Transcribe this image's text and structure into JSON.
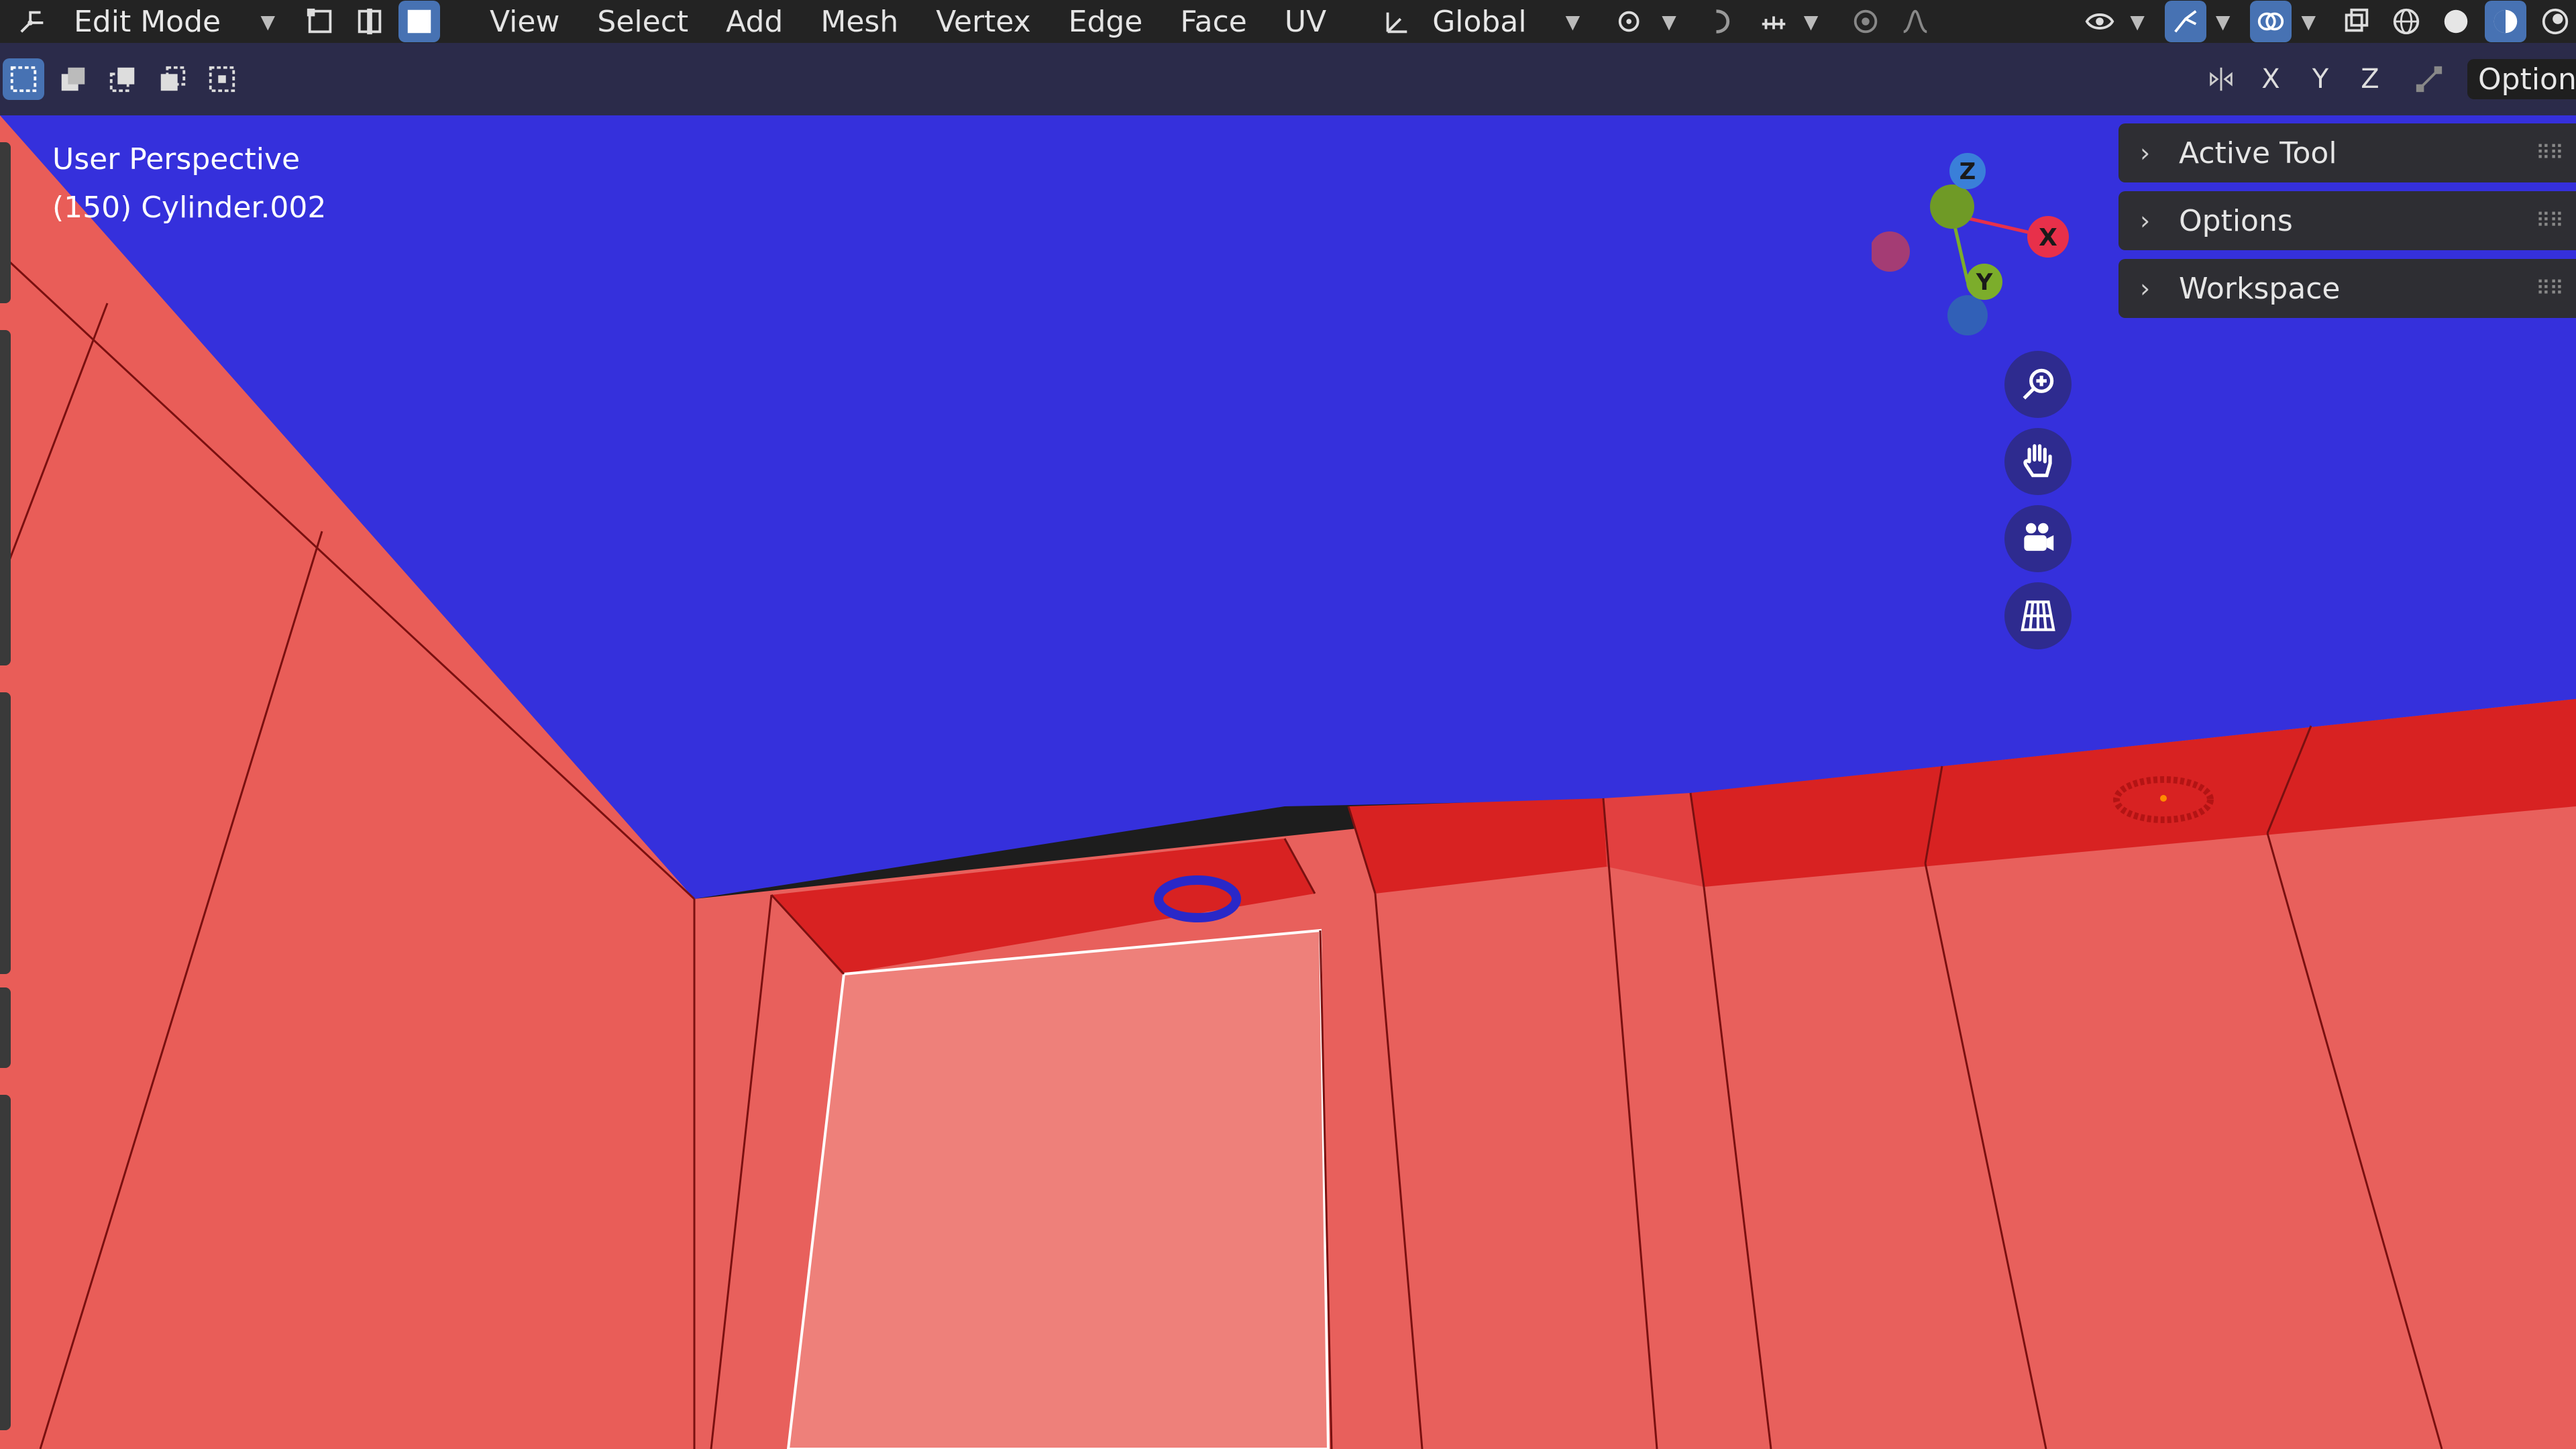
{
  "topbar": {
    "mode_label": "Edit Mode",
    "menus": [
      "View",
      "Select",
      "Add",
      "Mesh",
      "Vertex",
      "Edge",
      "Face",
      "UV"
    ],
    "orientation_label": "Global"
  },
  "toolbar2": {
    "axes": [
      "X",
      "Y",
      "Z"
    ],
    "options_label": "Option"
  },
  "viewport": {
    "view_name": "User Perspective",
    "object_info": "(150) Cylinder.002"
  },
  "npanel": {
    "sections": [
      "Active Tool",
      "Options",
      "Workspace"
    ]
  },
  "gizmo": {
    "labels": {
      "x": "X",
      "y": "Y",
      "z": "Z"
    },
    "colors": {
      "x": "#e8304a",
      "y": "#7cad2b",
      "z": "#3a7fd9"
    }
  },
  "colors": {
    "ceiling": "#3530dc",
    "wall": "#e85f5c",
    "wall_selected": "#ed7f79",
    "trim": "#d92424",
    "accent": "#4772b3"
  },
  "icons": [
    "editor-type-icon",
    "vertex-select-icon",
    "edge-select-icon",
    "face-select-icon",
    "transform-orientation-icon",
    "pivot-icon",
    "snap-icon",
    "proportional-edit-icon",
    "visibility-icon",
    "gizmo-icon",
    "overlay-icon",
    "xray-icon",
    "wireframe-shading-icon",
    "solid-shading-icon",
    "material-shading-icon",
    "rendered-shading-icon",
    "zoom-icon",
    "hand-pan-icon",
    "camera-icon",
    "ortho-grid-icon"
  ]
}
